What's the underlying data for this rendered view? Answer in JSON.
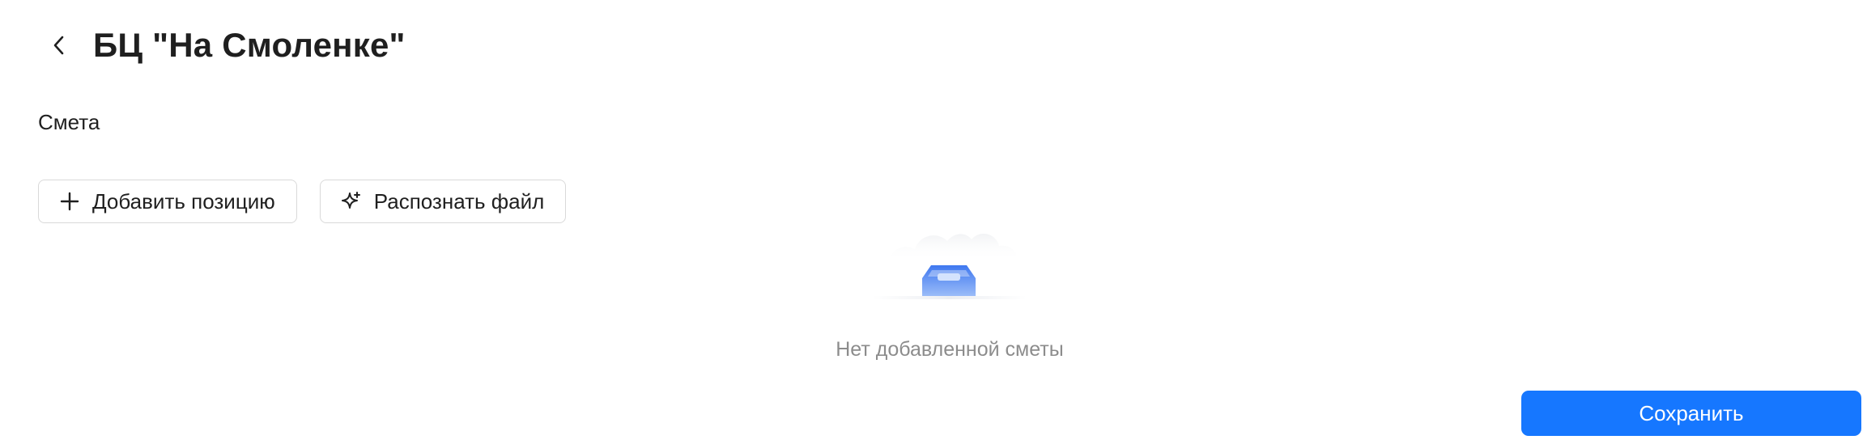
{
  "header": {
    "title": "БЦ \"На Смоленке\"",
    "back_icon": "chevron-left-icon"
  },
  "section": {
    "label": "Смета"
  },
  "toolbar": {
    "add_label": "Добавить позицию",
    "add_icon": "plus-icon",
    "recognize_label": "Распознать файл",
    "recognize_icon": "sparkle-icon"
  },
  "empty_state": {
    "icon": "empty-inbox-icon",
    "text": "Нет добавленной сметы"
  },
  "footer": {
    "save_label": "Сохранить"
  },
  "colors": {
    "primary": "#1677ff",
    "text": "#1f1f1f",
    "muted": "#8c8c8c",
    "border": "#d9d9d9"
  }
}
